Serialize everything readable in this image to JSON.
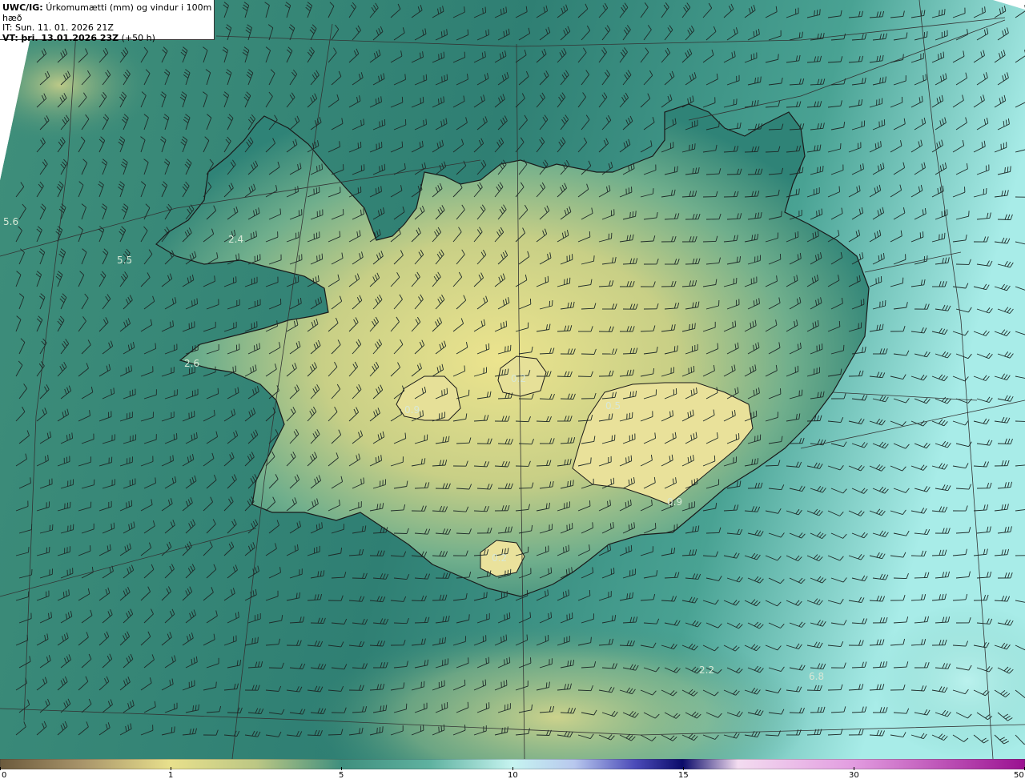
{
  "title": {
    "product": "UWC/IG:",
    "field": "Úrkomumætti (mm) og vindur i 100m hæð",
    "it": "IT: Sun. 11. 01. 2026 21Z",
    "vt_label": "VT:",
    "vt": "þri. 13.01.2026 23Z",
    "vt_offset": "(+50 h)"
  },
  "value_labels": [
    "5.6",
    "5.5",
    "2.4",
    "2.6",
    "0.9",
    "0.2",
    "0.5",
    "0.9",
    "0.2",
    "2.2",
    "6.8"
  ],
  "colorbar": {
    "ticks": [
      "0",
      "1",
      "5",
      "10",
      "15",
      "30",
      "50"
    ],
    "colors": [
      "#6b5a3c",
      "#b8a46e",
      "#e8e08c",
      "#6fa890",
      "#2e7f74",
      "#aef0ee",
      "#dff6fb",
      "#4a4ab8",
      "#101070",
      "#e6a0e6",
      "#c040c0",
      "#9a1090"
    ]
  },
  "colors": {
    "land": "#d9d68a",
    "sea_dark": "#2a7a6e",
    "sea_mid": "#5aa58f",
    "sea_light": "#b8f0ee",
    "barb": "#1e2a28"
  }
}
